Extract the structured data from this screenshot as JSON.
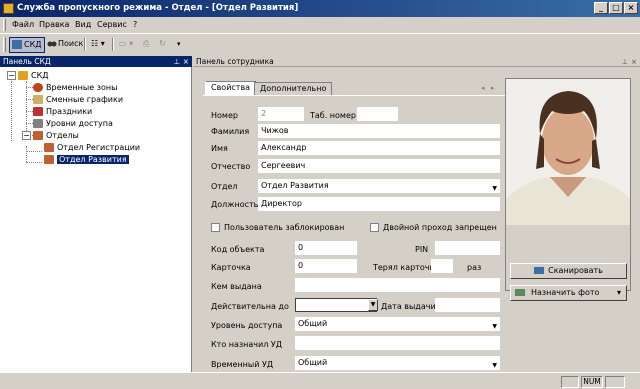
{
  "window": {
    "title": "Служба пропускного режима - Отдел - [Отдел Развития]",
    "buttons": {
      "minimize": "_",
      "restore": "□",
      "close": "×"
    }
  },
  "menu": {
    "items": [
      "Файл",
      "Правка",
      "Вид",
      "Сервис",
      "?"
    ]
  },
  "toolbar": {
    "skd": "СКД",
    "search": "Поиск"
  },
  "left_panel": {
    "title": "Панель СКД",
    "tree": {
      "root": "СКД",
      "items": [
        "Временные зоны",
        "Сменные графики",
        "Праздники",
        "Уровни доступа"
      ],
      "group": "Отделы",
      "departments": [
        "Отдел Регистрации",
        "Отдел Развития"
      ]
    }
  },
  "right_panel": {
    "title": "Панель сотрудника",
    "tabs": [
      "Свойства",
      "Дополнительно"
    ]
  },
  "form": {
    "number_label": "Номер",
    "number_value": "2",
    "tab_number_label": "Таб. номер",
    "tab_number_value": "",
    "lastname_label": "Фамилия",
    "lastname_value": "Чижов",
    "firstname_label": "Имя",
    "firstname_value": "Александр",
    "patronymic_label": "Отчество",
    "patronymic_value": "Сергеевич",
    "department_label": "Отдел",
    "department_value": "Отдел Развития",
    "position_label": "Должность",
    "position_value": "Директор",
    "blocked_label": "Пользователь заблокирован",
    "double_pass_label": "Двойной проход запрещен",
    "object_code_label": "Код объекта",
    "object_code_value": "0",
    "pin_label": "PIN",
    "pin_value": "",
    "card_label": "Карточка",
    "card_value": "0",
    "lost_cards_label": "Терял карточку",
    "lost_cards_value": "",
    "times_label": "раз",
    "issued_by_label": "Кем выдана",
    "issued_by_value": "",
    "valid_until_label": "Действительна до",
    "valid_until_value": "",
    "issue_date_label": "Дата выдачи",
    "issue_date_value": "",
    "access_level_label": "Уровень доступа",
    "access_level_value": "Общий",
    "assigned_by_label": "Кто назначил УД",
    "assigned_by_value": "",
    "temp_level_label": "Временный УД",
    "temp_level_value": "Общий"
  },
  "photo": {
    "scan_button": "Сканировать",
    "assign_button": "Назначить фото"
  },
  "status": {
    "num": "NUM"
  }
}
